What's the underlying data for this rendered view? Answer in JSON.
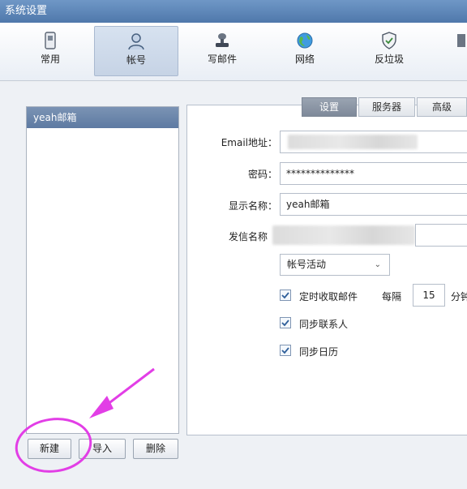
{
  "window": {
    "title": "系统设置"
  },
  "toolbar": {
    "items": [
      {
        "label": "常用",
        "icon": "phone-icon"
      },
      {
        "label": "帐号",
        "icon": "user-icon"
      },
      {
        "label": "写邮件",
        "icon": "stamp-icon"
      },
      {
        "label": "网络",
        "icon": "globe-icon"
      },
      {
        "label": "反垃圾",
        "icon": "shield-icon"
      }
    ],
    "active_index": 1
  },
  "accounts": {
    "items": [
      "yeah邮箱"
    ],
    "selected_index": 0
  },
  "account_buttons": {
    "new": "新建",
    "import": "导入",
    "delete": "删除"
  },
  "tabs": [
    "设置",
    "服务器",
    "高级"
  ],
  "form": {
    "email_label": "Email地址：",
    "email_value": "",
    "password_label": "密码：",
    "password_value": "**************",
    "display_name_label": "显示名称：",
    "display_name_value": "yeah邮箱",
    "sender_name_label": "发信名称",
    "sender_name_value": "",
    "status_value": "帐号活动",
    "auto_receive_label": "定时收取邮件",
    "interval_label": "每隔",
    "interval_value": "15",
    "interval_unit": "分钟",
    "sync_contacts_label": "同步联系人",
    "sync_calendar_label": "同步日历"
  },
  "colors": {
    "accent": "#5d7aa2",
    "annotation": "#e23ee6"
  }
}
